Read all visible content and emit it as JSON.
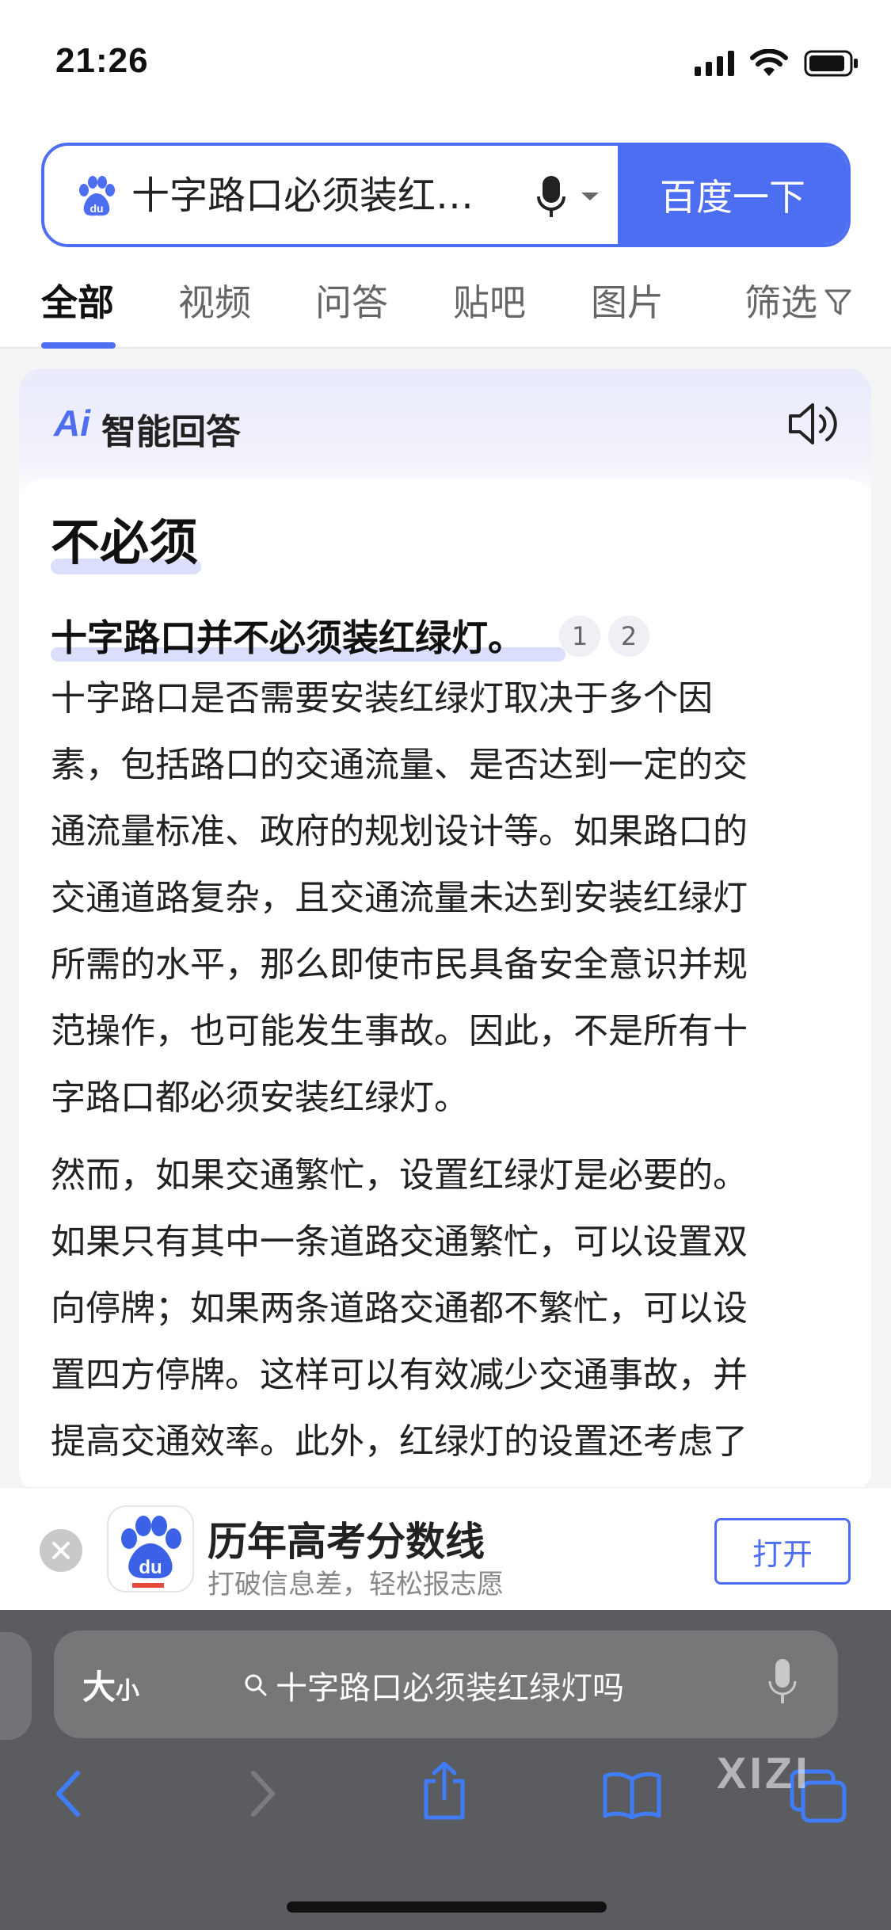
{
  "status_bar": {
    "time": "21:26"
  },
  "search": {
    "query": "十字路口必须装红绿灯吗",
    "button_label": "百度一下"
  },
  "tabs": {
    "items": [
      "全部",
      "视频",
      "问答",
      "贴吧",
      "图片"
    ],
    "active_index": 0,
    "filter_label": "筛选"
  },
  "ai_answer": {
    "logo": "Ai",
    "title": "智能回答",
    "headline": "不必须",
    "summary": "十字路口并不必须装红绿灯。",
    "citations": [
      "1",
      "2"
    ],
    "paragraph1_lines": [
      "十字路口是否需要安装红绿灯取决于多个因",
      "素，包括路口的交通流量、是否达到一定的交",
      "通流量标准、政府的规划设计等。如果路口的",
      "交通道路复杂，且交通流量未达到安装红绿灯",
      "所需的水平，那么即使市民具备安全意识并规",
      "范操作，也可能发生事故。因此，不是所有十",
      "字路口都必须安装红绿灯。"
    ],
    "paragraph2_lines": [
      "然而，如果交通繁忙，设置红绿灯是必要的。",
      "如果只有其中一条道路交通繁忙，可以设置双",
      "向停牌；如果两条道路交通都不繁忙，可以设",
      "置四方停牌。这样可以有效减少交通事故，并",
      "提高交通效率。此外，红绿灯的设置还考虑了"
    ]
  },
  "promo": {
    "title": "历年高考分数线",
    "subtitle": "打破信息差，轻松报志愿",
    "open_label": "打开",
    "app_icon_text": "du"
  },
  "browser": {
    "text_size_label": "大",
    "text_size_small": "小",
    "address": "十字路口必须装红绿灯吗"
  },
  "watermark": "XIZI",
  "colors": {
    "accent": "#4e6ef2",
    "toolbar": "#5b5c60"
  }
}
